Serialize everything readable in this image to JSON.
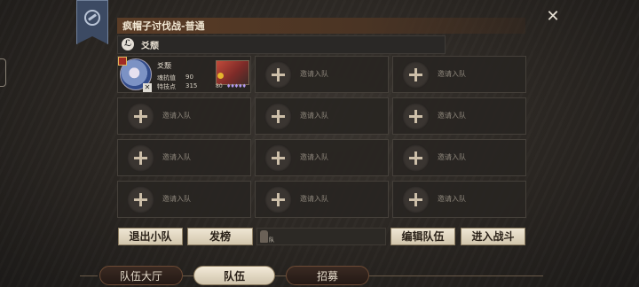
{
  "header": {
    "title": "疯帽子讨伐战-普通",
    "close_icon": "close-icon",
    "close_glyph": "✕",
    "banner_icon": "guild-banner-icon"
  },
  "team": {
    "section_icon_glyph": "ℒ",
    "section_label": "爻颓"
  },
  "member": {
    "name": "爻颓",
    "stats": [
      {
        "label": "魂抗值",
        "value": "90"
      },
      {
        "label": "特技点",
        "value": "315"
      }
    ],
    "leave_glyph": "✕",
    "pet_level": "80",
    "pet_stars": "♦♦♦♦♦"
  },
  "empty_slot": {
    "invite_label": "邀请入队"
  },
  "buttons": {
    "leave_team": "退出小队",
    "post": "发榜",
    "edit_team": "编辑队伍",
    "enter_battle": "进入战斗"
  },
  "chat": {
    "label": "队"
  },
  "tabs": [
    {
      "label": "队伍大厅",
      "active": false
    },
    {
      "label": "队伍",
      "active": true
    },
    {
      "label": "招募",
      "active": false
    }
  ],
  "colors": {
    "accent_brown": "#5a3c26",
    "button_cream": "#efe6d3",
    "banner_blue": "#3c4a63"
  }
}
